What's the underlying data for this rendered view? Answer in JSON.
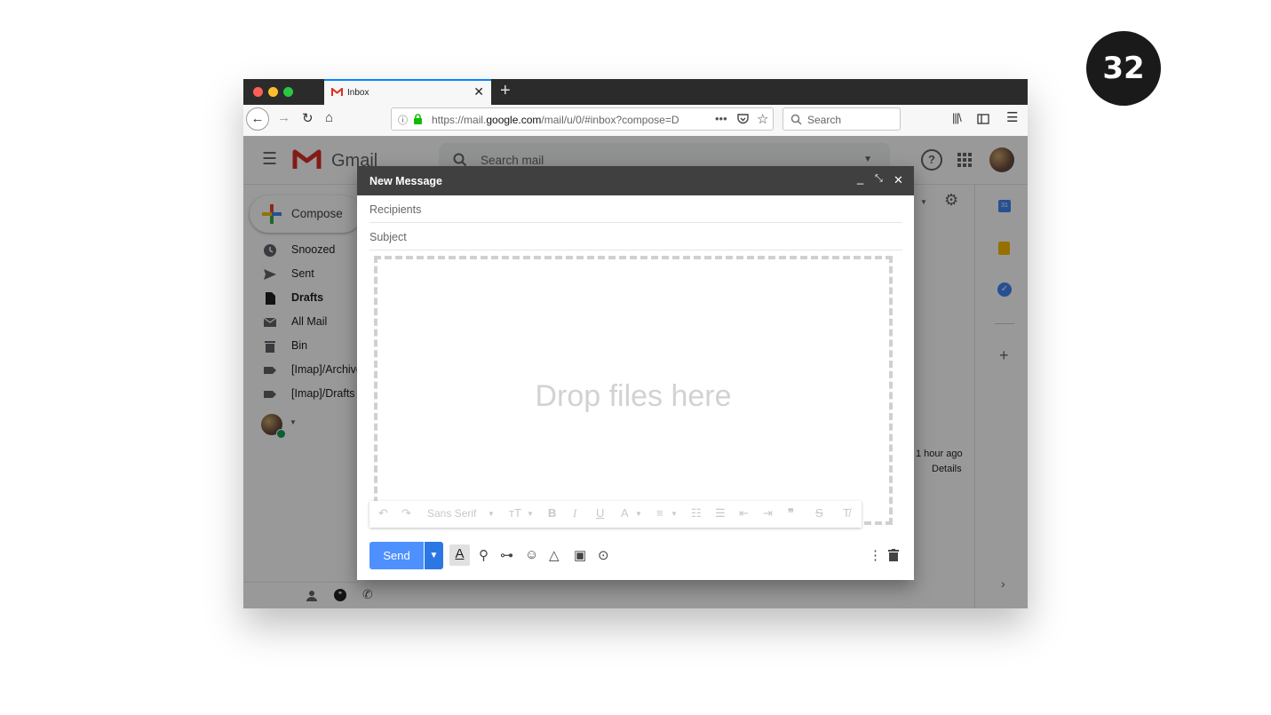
{
  "slide_number": "32",
  "browser": {
    "tab_title": "Inbox",
    "url_prefix": "https://mail.",
    "url_domain": "google.com",
    "url_suffix": "/mail/u/0/#inbox?compose=D",
    "search_placeholder": "Search",
    "colors": {
      "traffic_red": "#fe5f57",
      "traffic_yellow": "#febc2e",
      "traffic_green": "#28c840",
      "tab_accent": "#0a84ff"
    }
  },
  "gmail": {
    "logo_text": "Gmail",
    "search_placeholder": "Search mail",
    "compose_label": "Compose",
    "sidebar": [
      {
        "label": "Snoozed",
        "icon": "clock-icon",
        "bold": false
      },
      {
        "label": "Sent",
        "icon": "send-icon",
        "bold": false
      },
      {
        "label": "Drafts",
        "icon": "draft-icon",
        "bold": true
      },
      {
        "label": "All Mail",
        "icon": "mail-icon",
        "bold": false
      },
      {
        "label": "Bin",
        "icon": "trash-icon",
        "bold": false
      },
      {
        "label": "[Imap]/Archive",
        "icon": "label-icon",
        "bold": false
      },
      {
        "label": "[Imap]/Drafts",
        "icon": "label-icon",
        "bold": false
      }
    ],
    "activity_time": "1 hour ago",
    "activity_details": "Details"
  },
  "compose": {
    "title": "New Message",
    "recipients_placeholder": "Recipients",
    "subject_placeholder": "Subject",
    "drop_text": "Drop files here",
    "font_name": "Sans Serif",
    "send_label": "Send",
    "colors": {
      "send": "#4d90fe",
      "send_dropdown": "#2b78e4",
      "header": "#404040"
    }
  }
}
